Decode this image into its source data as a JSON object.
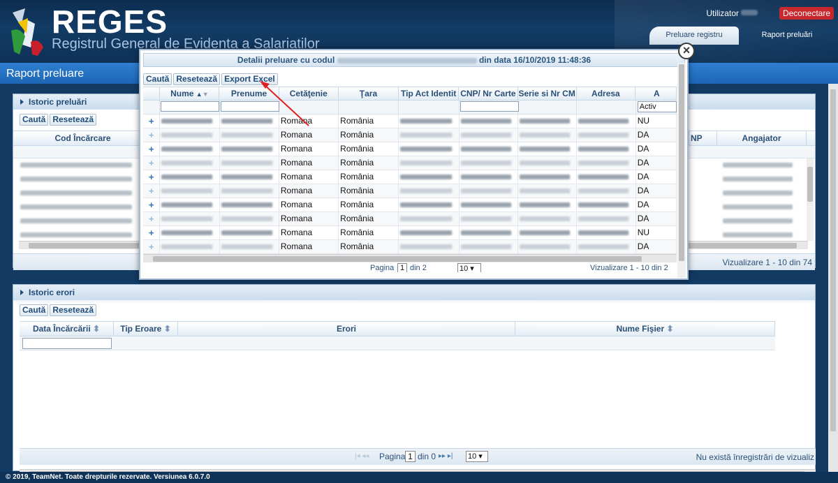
{
  "header": {
    "logo_title": "REGES",
    "logo_subtitle": "Registrul General de Evidenta a Salariatilor",
    "user_label": "Utilizator",
    "logout_label": "Deconectare",
    "tabs": [
      {
        "label": "Preluare registru"
      },
      {
        "label": "Raport preluări"
      }
    ]
  },
  "page": {
    "title": "Raport preluare"
  },
  "history_panel": {
    "title": "Istoric preluări",
    "search_label": "Caută",
    "reset_label": "Resetează",
    "columns": {
      "cod": "Cod Încărcare",
      "cnp": "NP",
      "angajator": "Angajator"
    },
    "pager_text": "Vizualizare 1 - 10 din 74"
  },
  "errors_panel": {
    "title": "Istoric erori",
    "search_label": "Caută",
    "reset_label": "Resetează",
    "columns": {
      "data": "Data Încărcării",
      "tip": "Tip Eroare",
      "erori": "Erori",
      "fisier": "Nume Fişier"
    },
    "pager": {
      "page_label": "Pagina",
      "page_value": "1",
      "of_label": "din 0",
      "page_size": "10"
    },
    "no_records": "Nu există înregistrări de vizualiz"
  },
  "modal": {
    "title_prefix": "Detalii preluare cu codul",
    "title_suffix": "din data 16/10/2019 11:48:36",
    "search_label": "Caută",
    "reset_label": "Resetează",
    "export_label": "Export Excel",
    "close_symbol": "×",
    "columns": {
      "nume": "Nume",
      "prenume": "Prenume",
      "cetatenie": "Cetăţenie",
      "tara": "Ţara",
      "tip_act": "Tip Act Identit",
      "cnp": "CNP/ Nr Carte",
      "serie": "Serie si Nr CM",
      "adresa": "Adresa"
    },
    "filter_select": "Activ",
    "rows": [
      {
        "cet": "Romana",
        "tara": "România",
        "act": "NU",
        "strong": true
      },
      {
        "cet": "Romana",
        "tara": "România",
        "act": "DA",
        "strong": false
      },
      {
        "cet": "Romana",
        "tara": "România",
        "act": "DA",
        "strong": true
      },
      {
        "cet": "Romana",
        "tara": "România",
        "act": "DA",
        "strong": false
      },
      {
        "cet": "Romana",
        "tara": "România",
        "act": "DA",
        "strong": true
      },
      {
        "cet": "Romana",
        "tara": "România",
        "act": "DA",
        "strong": false
      },
      {
        "cet": "Romana",
        "tara": "România",
        "act": "DA",
        "strong": true
      },
      {
        "cet": "Romana",
        "tara": "România",
        "act": "DA",
        "strong": false
      },
      {
        "cet": "Romana",
        "tara": "România",
        "act": "NU",
        "strong": true
      },
      {
        "cet": "Romana",
        "tara": "România",
        "act": "DA",
        "strong": false
      }
    ],
    "pager": {
      "page_label": "Pagina",
      "page_value": "1",
      "of_label": "din 2",
      "page_size": "10",
      "summary": "Vizualizare 1 - 10 din 2"
    }
  },
  "footer": {
    "text": "© 2019, TeamNet. Toate drepturile rezervate. Versiunea 6.0.7.0"
  }
}
